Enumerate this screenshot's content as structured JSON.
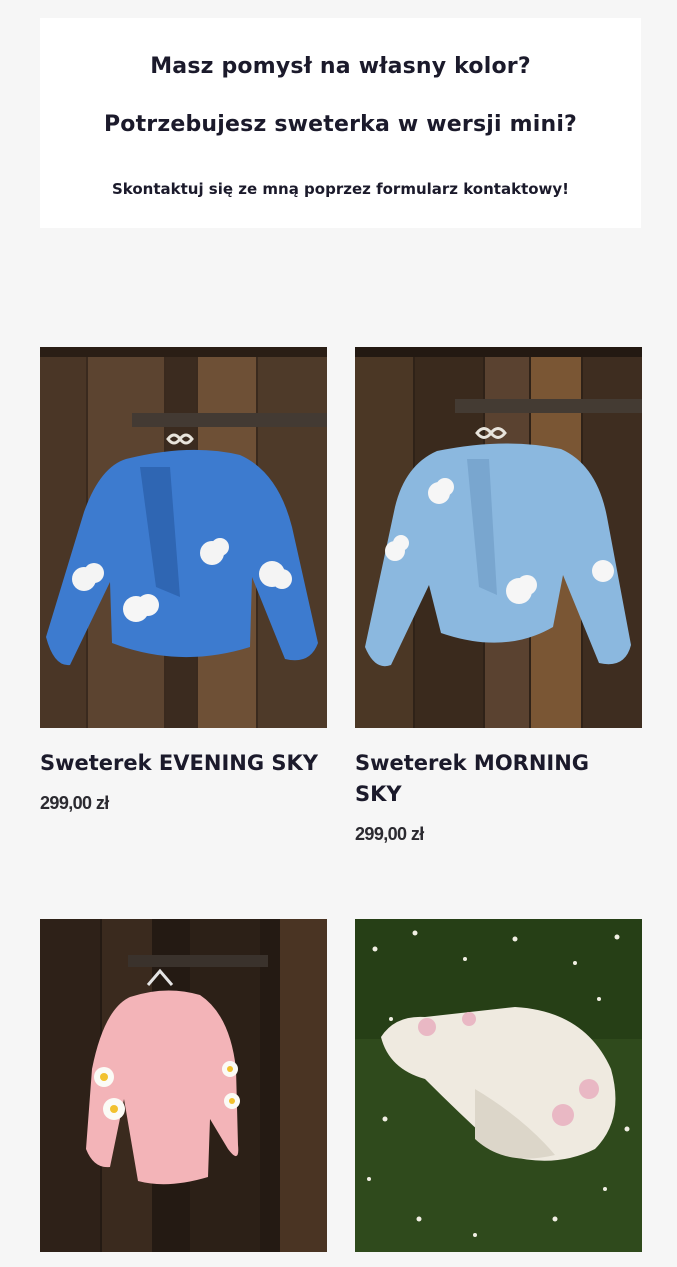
{
  "promo": {
    "question_1": "Masz pomysł na własny kolor?",
    "question_2": "Potrzebujesz sweterka w wersji mini?",
    "cta": "Skontaktuj się ze mną poprzez formularz kontaktowy!"
  },
  "products": [
    {
      "title": "Sweterek EVENING SKY",
      "price": "299,00 zł",
      "image": "blue-cardigan-with-clouds-on-wooden-wall",
      "color": "#3d7bcf"
    },
    {
      "title": "Sweterek MORNING SKY",
      "price": "299,00 zł",
      "image": "light-blue-cardigan-with-clouds-on-wooden-wall",
      "color": "#8bb8df"
    },
    {
      "title": "",
      "price": "",
      "image": "pink-cardigan-with-daisies-on-wooden-wall",
      "color": "#f3b4b8"
    },
    {
      "title": "",
      "price": "",
      "image": "cream-cardigan-with-pink-flowers-on-grass",
      "color": "#efeae0"
    }
  ]
}
